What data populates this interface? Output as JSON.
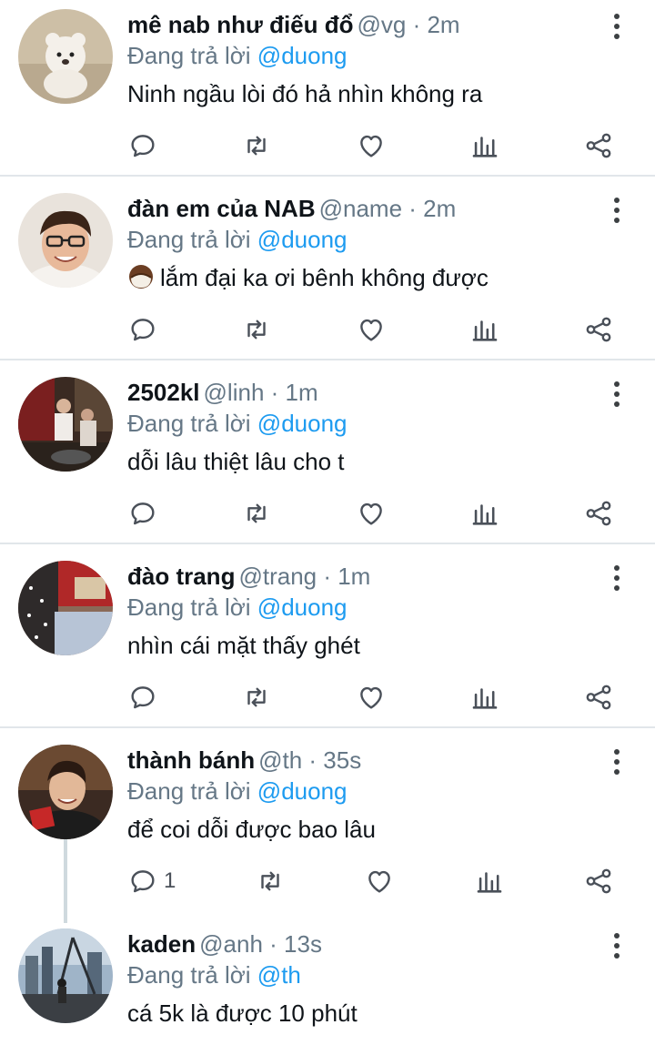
{
  "reply_prefix": "Đang trả lời",
  "colors": {
    "accent": "#1d9bf0",
    "muted": "#657786",
    "text": "#0f1419",
    "divider": "#e1e6ea"
  },
  "tweets": [
    {
      "name": "mê nab như điếu đổ",
      "handle": "@vg",
      "time": "· 2m",
      "reply_to": "@duong",
      "text": "Ninh ngầu lòi đó hả nhìn không ra",
      "emoji": "",
      "reply_count": ""
    },
    {
      "name": "đàn em của NAB",
      "handle": "@name",
      "time": "· 2m",
      "reply_to": "@duong",
      "text": "lắm đại ka ơi bênh không được",
      "emoji": "coconut-emoji",
      "reply_count": ""
    },
    {
      "name": "2502kl",
      "handle": "@linh",
      "time": "· 1m",
      "reply_to": "@duong",
      "text": "dỗi lâu thiệt lâu cho t",
      "emoji": "",
      "reply_count": ""
    },
    {
      "name": "đào trang",
      "handle": "@trang",
      "time": "· 1m",
      "reply_to": "@duong",
      "text": "nhìn cái mặt thấy ghét",
      "emoji": "",
      "reply_count": ""
    },
    {
      "name": "thành bánh",
      "handle": "@th",
      "time": "· 35s",
      "reply_to": "@duong",
      "text": "để coi dỗi được bao lâu",
      "emoji": "",
      "reply_count": "1"
    },
    {
      "name": "kaden",
      "handle": "@anh",
      "time": "· 13s",
      "reply_to": "@th",
      "text": "cá 5k là được 10 phút",
      "emoji": "",
      "reply_count": ""
    }
  ]
}
